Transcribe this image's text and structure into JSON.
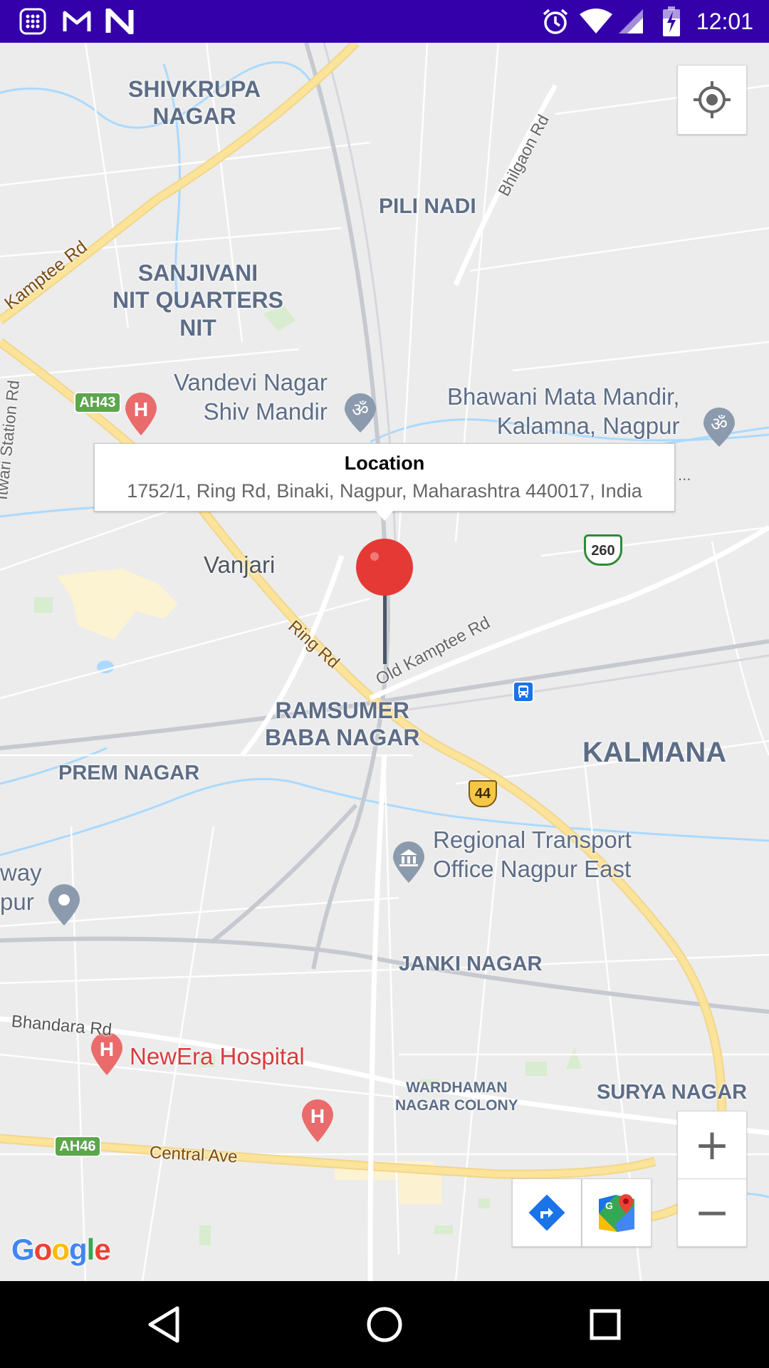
{
  "status_bar": {
    "time": "12:01",
    "icons": [
      "calculator-app-icon",
      "gmail-icon",
      "app-n-icon",
      "alarm-icon",
      "wifi-icon",
      "cell-signal-icon",
      "battery-icon"
    ]
  },
  "map": {
    "places": [
      {
        "name": "shivkrupa",
        "text": "SHIVKRUPA\nNAGAR"
      },
      {
        "name": "pili-nadi",
        "text": "PILI NADI"
      },
      {
        "name": "sanjivani",
        "text": "SANJIVANI\nNIT QUARTERS\nNIT"
      },
      {
        "name": "ramsumer",
        "text": "RAMSUMER\nBABA NAGAR"
      },
      {
        "name": "kalmana",
        "text": "KALMANA"
      },
      {
        "name": "prem-nagar",
        "text": "PREM NAGAR"
      },
      {
        "name": "janki-nagar",
        "text": "JANKI NAGAR"
      },
      {
        "name": "wardhaman",
        "text": "WARDHAMAN\nNAGAR COLONY"
      },
      {
        "name": "surya-nagar",
        "text": "SURYA NAGAR"
      }
    ],
    "pois": [
      {
        "name": "vandevi",
        "text": "Vandevi Nagar\nShiv Mandir",
        "icon": "temple-icon"
      },
      {
        "name": "bhawani",
        "text": "Bhawani Mata Mandir,\nKalamna, Nagpur",
        "icon": "temple-icon"
      },
      {
        "name": "vanjari",
        "text": "Vanjari"
      },
      {
        "name": "rto",
        "text": "Regional Transport\nOffice Nagpur East",
        "icon": "government-building-icon"
      },
      {
        "name": "newera",
        "text": "NewEra Hospital",
        "icon": "hospital-icon"
      },
      {
        "name": "way-pur",
        "text": "way\npur",
        "icon": "place-pin-icon"
      }
    ],
    "roads": [
      {
        "name": "kamptee-rd",
        "text": "Kamptee Rd"
      },
      {
        "name": "bhilgaon-rd",
        "text": "Bhilgaon Rd"
      },
      {
        "name": "itwari-station-rd",
        "text": "Itwari Station Rd"
      },
      {
        "name": "ring-rd",
        "text": "Ring Rd"
      },
      {
        "name": "old-kamptee-rd",
        "text": "Old Kamptee Rd"
      },
      {
        "name": "bhandara-rd",
        "text": "Bhandara Rd"
      },
      {
        "name": "central-ave",
        "text": "Central Ave"
      }
    ],
    "shields": {
      "ah43": "AH43",
      "ah46": "AH46",
      "nh44": "44",
      "nh260": "260"
    },
    "ellipsis": "...",
    "google_logo": "Google",
    "colors": {
      "marker": "#e53935",
      "highway": "#fbe39a",
      "water": "#aadaff",
      "land": "#ececec",
      "status_bar": "#3300aa"
    }
  },
  "infowindow": {
    "title": "Location",
    "snippet": "1752/1, Ring Rd, Binaki, Nagpur, Maharashtra 440017, India"
  },
  "controls": {
    "my_location": "my-location-icon",
    "zoom_in": "+",
    "zoom_out": "−",
    "directions": "directions-icon",
    "open_maps": "google-maps-icon"
  },
  "nav_bar": {
    "buttons": [
      "back-icon",
      "home-icon",
      "recents-icon"
    ]
  }
}
